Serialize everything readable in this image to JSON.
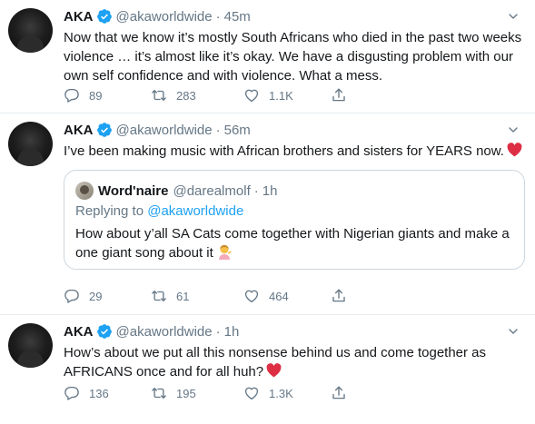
{
  "colors": {
    "accent": "#1da1f2",
    "muted": "#657786",
    "text": "#14171a",
    "heart": "#e0245e",
    "border": "#e6ecf0"
  },
  "tweets": [
    {
      "name": "AKA",
      "handle": "@akaworldwide",
      "time": "45m",
      "text": "Now that we know it’s mostly South Africans who died in the past two weeks violence … it’s almost like it’s okay. We have a disgusting problem with our own self confidence and with violence. What a mess.",
      "replies": "89",
      "retweets": "283",
      "likes": "1.1K"
    },
    {
      "name": "AKA",
      "handle": "@akaworldwide",
      "time": "56m",
      "text": "I’ve been making music with African brothers and sisters for YEARS now.",
      "quote": {
        "name": "Word'naire",
        "handle": "@darealmolf",
        "time": "1h",
        "replying_prefix": "Replying to",
        "replying_to": "@akaworldwide",
        "text": "How about y’all SA Cats come together with Nigerian giants and make a one giant song about it"
      },
      "replies": "29",
      "retweets": "61",
      "likes": "464"
    },
    {
      "name": "AKA",
      "handle": "@akaworldwide",
      "time": "1h",
      "text": "How’s about we put all this nonsense behind us and come together as AFRICANS once and for all huh?",
      "replies": "136",
      "retweets": "195",
      "likes": "1.3K"
    }
  ],
  "icons": {
    "verified": "verified-badge-icon",
    "menu": "chevron-down-icon",
    "reply": "reply-icon",
    "retweet": "retweet-icon",
    "like": "like-icon",
    "share": "share-icon",
    "heart_emoji": "red-heart-emoji",
    "person_emoji": "person-tipping-hand-emoji"
  }
}
